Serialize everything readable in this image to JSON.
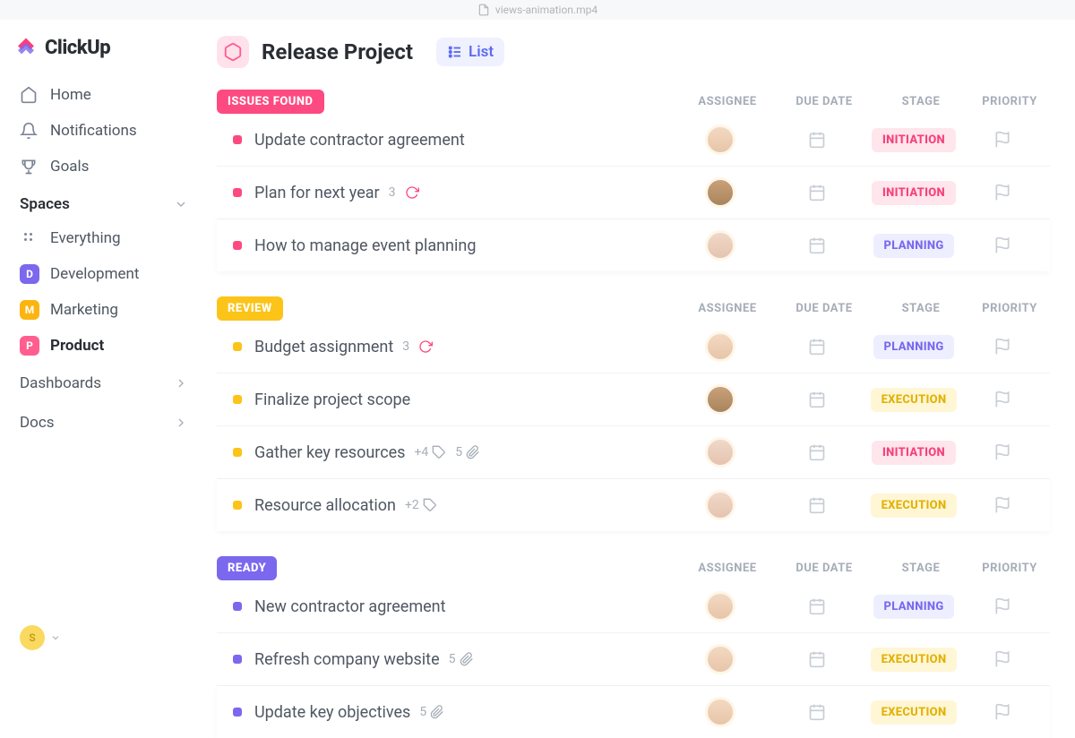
{
  "topbar": {
    "file": "views-animation.mp4"
  },
  "brand": "ClickUp",
  "nav": {
    "home": "Home",
    "notifications": "Notifications",
    "goals": "Goals"
  },
  "spaces": {
    "header": "Spaces",
    "everything": "Everything",
    "items": [
      {
        "badge": "D",
        "label": "Development",
        "color": "#7b68ee",
        "active": false
      },
      {
        "badge": "M",
        "label": "Marketing",
        "color": "#fcb410",
        "active": false
      },
      {
        "badge": "P",
        "label": "Product",
        "color": "#ff5e8e",
        "active": true
      }
    ]
  },
  "sections": {
    "dashboards": "Dashboards",
    "docs": "Docs"
  },
  "user": {
    "initial": "S"
  },
  "project": {
    "title": "Release Project",
    "view": "List"
  },
  "columns": {
    "assignee": "ASSIGNEE",
    "due": "DUE DATE",
    "stage": "STAGE",
    "priority": "PRIORITY"
  },
  "stages": {
    "initiation": "INITIATION",
    "planning": "PLANNING",
    "execution": "EXECUTION"
  },
  "groups": [
    {
      "status": "ISSUES FOUND",
      "color": "#fd4a80",
      "tasks": [
        {
          "title": "Update contractor agreement",
          "stage": "initiation",
          "avatar": 1
        },
        {
          "title": "Plan for next year",
          "count": "3",
          "recur": true,
          "stage": "initiation",
          "avatar": 2
        },
        {
          "title": "How to manage event planning",
          "stage": "planning",
          "avatar": 3
        }
      ]
    },
    {
      "status": "REVIEW",
      "color": "#fcc419",
      "tasks": [
        {
          "title": "Budget assignment",
          "count": "3",
          "recur": true,
          "stage": "planning",
          "avatar": 1
        },
        {
          "title": "Finalize project scope",
          "stage": "execution",
          "avatar": 2
        },
        {
          "title": "Gather key resources",
          "tags": "+4",
          "attach": "5",
          "stage": "initiation",
          "avatar": 3
        },
        {
          "title": "Resource allocation",
          "tags": "+2",
          "stage": "execution",
          "avatar": 3
        }
      ]
    },
    {
      "status": "READY",
      "color": "#7b68ee",
      "tasks": [
        {
          "title": "New contractor agreement",
          "stage": "planning",
          "avatar": 1
        },
        {
          "title": "Refresh company website",
          "attach": "5",
          "stage": "execution",
          "avatar": 1
        },
        {
          "title": "Update key objectives",
          "attach": "5",
          "stage": "execution",
          "avatar": 1
        }
      ]
    }
  ]
}
